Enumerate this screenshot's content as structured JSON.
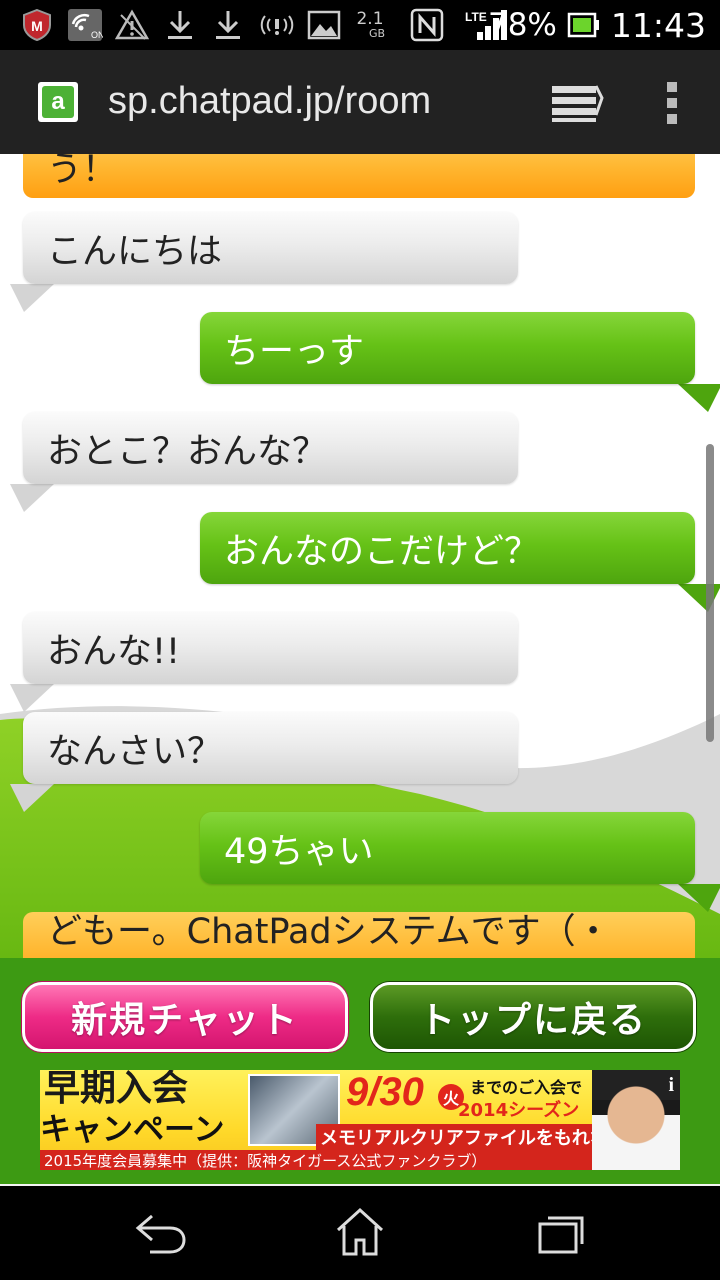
{
  "status_bar": {
    "storage": "2.1",
    "storage_unit": "GB",
    "network": "LTE",
    "battery": "78%",
    "time": "11:43",
    "icons": [
      "mcafee-icon",
      "wifi-on-icon",
      "warning-icon",
      "download-icon",
      "download-icon",
      "nfc-signal-icon",
      "image-icon",
      "storage-icon",
      "nfc-icon",
      "signal-icon",
      "battery-icon"
    ]
  },
  "browser": {
    "favicon_letter": "a",
    "url": "sp.chatpad.jp/room"
  },
  "chat": {
    "top_system_fragment": "う！",
    "messages": [
      {
        "side": "left",
        "text": "こんにちは"
      },
      {
        "side": "right",
        "text": "ちーっす"
      },
      {
        "side": "left",
        "text": "おとこ？おんな？"
      },
      {
        "side": "right",
        "text": "おんなのこだけど？"
      },
      {
        "side": "left",
        "text": "おんな!!"
      },
      {
        "side": "left",
        "text": "なんさい？"
      },
      {
        "side": "right",
        "text": "49ちゃい"
      }
    ],
    "bottom_system_fragment": "どもー。ChatPadシステムです（・"
  },
  "actions": {
    "new_chat": "新規チャット",
    "back_to_top": "トップに戻る"
  },
  "ad": {
    "headline_1": "早期入会",
    "headline_2": "キャンペーン",
    "recruit": "2015年度会員募集中（提供：阪神タイガース公式ファンクラブ）",
    "date": "9/30",
    "weekday": "火",
    "line_1": "までのご入会で",
    "line_2": "2014シーズン",
    "line_3": "メモリアルクリアファイルをもれなく!",
    "info": "i"
  },
  "colors": {
    "green_bubble": "#66c217",
    "gray_bubble": "#e6e6e6",
    "system_bubble": "#ffb52e",
    "panel": "#3d9a13",
    "new_chat_button": "#ee2b86",
    "top_button": "#2e6e0b"
  }
}
